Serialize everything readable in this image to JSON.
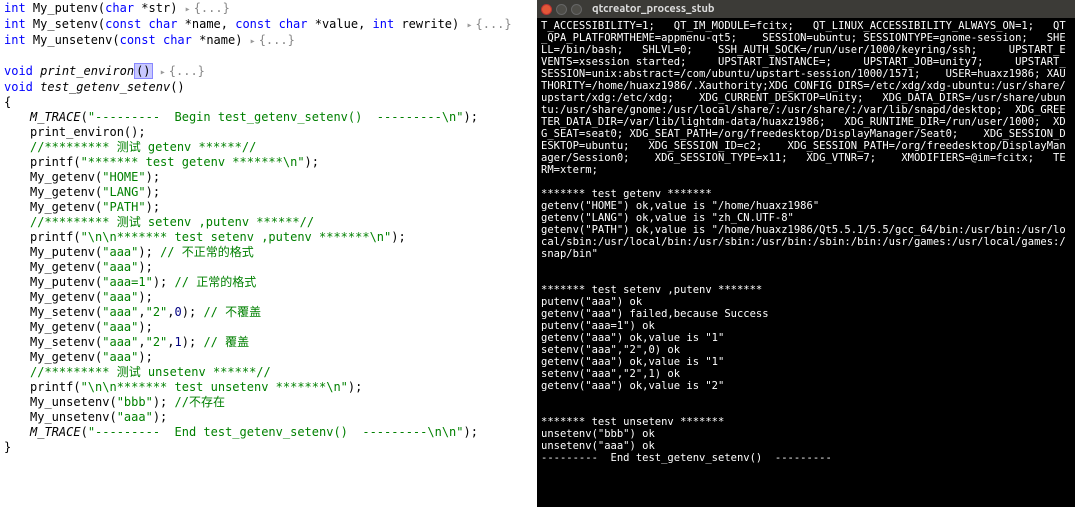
{
  "editor": {
    "lines": [
      {
        "indent": 0,
        "tokens": [
          {
            "t": "kw",
            "v": "int"
          },
          {
            "t": "",
            "v": " My_putenv("
          },
          {
            "t": "kw",
            "v": "char"
          },
          {
            "t": "",
            "v": " *str) "
          },
          {
            "t": "fold",
            "v": "{...}"
          }
        ]
      },
      {
        "indent": 0,
        "tokens": [
          {
            "t": "kw",
            "v": "int"
          },
          {
            "t": "",
            "v": " My_setenv("
          },
          {
            "t": "kw",
            "v": "const"
          },
          {
            "t": "",
            "v": " "
          },
          {
            "t": "kw",
            "v": "char"
          },
          {
            "t": "",
            "v": " *name, "
          },
          {
            "t": "kw",
            "v": "const"
          },
          {
            "t": "",
            "v": " "
          },
          {
            "t": "kw",
            "v": "char"
          },
          {
            "t": "",
            "v": " *value, "
          },
          {
            "t": "kw",
            "v": "int"
          },
          {
            "t": "",
            "v": " rewrite) "
          },
          {
            "t": "fold",
            "v": "{...}"
          }
        ]
      },
      {
        "indent": 0,
        "tokens": [
          {
            "t": "kw",
            "v": "int"
          },
          {
            "t": "",
            "v": " My_unsetenv("
          },
          {
            "t": "kw",
            "v": "const"
          },
          {
            "t": "",
            "v": " "
          },
          {
            "t": "kw",
            "v": "char"
          },
          {
            "t": "",
            "v": " *name) "
          },
          {
            "t": "fold",
            "v": "{...}"
          }
        ]
      },
      {
        "indent": 0,
        "tokens": []
      },
      {
        "indent": 0,
        "tokens": [
          {
            "t": "kw",
            "v": "void"
          },
          {
            "t": "",
            "v": " "
          },
          {
            "t": "fn",
            "v": "print_environ"
          },
          {
            "t": "car",
            "v": "()"
          },
          {
            "t": "",
            "v": " "
          },
          {
            "t": "fold",
            "v": "{...}"
          }
        ]
      },
      {
        "indent": 0,
        "tokens": [
          {
            "t": "kw",
            "v": "void"
          },
          {
            "t": "",
            "v": " "
          },
          {
            "t": "fn",
            "v": "test_getenv_setenv"
          },
          {
            "t": "",
            "v": "()"
          }
        ]
      },
      {
        "indent": 0,
        "tokens": [
          {
            "t": "",
            "v": "{"
          }
        ]
      },
      {
        "indent": 1,
        "tokens": [
          {
            "t": "fn",
            "v": "M_TRACE"
          },
          {
            "t": "",
            "v": "("
          },
          {
            "t": "str",
            "v": "\"---------  Begin test_getenv_setenv()  ---------\\n\""
          },
          {
            "t": "",
            "v": ");"
          }
        ]
      },
      {
        "indent": 1,
        "tokens": [
          {
            "t": "",
            "v": "print_environ();"
          }
        ]
      },
      {
        "indent": 1,
        "tokens": [
          {
            "t": "cmt",
            "v": "//********* 测试 getenv ******//"
          }
        ]
      },
      {
        "indent": 1,
        "tokens": [
          {
            "t": "",
            "v": "printf("
          },
          {
            "t": "str",
            "v": "\"******* test getenv *******\\n\""
          },
          {
            "t": "",
            "v": ");"
          }
        ]
      },
      {
        "indent": 1,
        "tokens": [
          {
            "t": "",
            "v": "My_getenv("
          },
          {
            "t": "str",
            "v": "\"HOME\""
          },
          {
            "t": "",
            "v": ");"
          }
        ]
      },
      {
        "indent": 1,
        "tokens": [
          {
            "t": "",
            "v": "My_getenv("
          },
          {
            "t": "str",
            "v": "\"LANG\""
          },
          {
            "t": "",
            "v": ");"
          }
        ]
      },
      {
        "indent": 1,
        "tokens": [
          {
            "t": "",
            "v": "My_getenv("
          },
          {
            "t": "str",
            "v": "\"PATH\""
          },
          {
            "t": "",
            "v": ");"
          }
        ]
      },
      {
        "indent": 1,
        "tokens": [
          {
            "t": "cmt",
            "v": "//********* 测试 setenv ,putenv ******//"
          }
        ]
      },
      {
        "indent": 1,
        "tokens": [
          {
            "t": "",
            "v": "printf("
          },
          {
            "t": "str",
            "v": "\"\\n\\n******* test setenv ,putenv *******\\n\""
          },
          {
            "t": "",
            "v": ");"
          }
        ]
      },
      {
        "indent": 1,
        "tokens": [
          {
            "t": "",
            "v": "My_putenv("
          },
          {
            "t": "str",
            "v": "\"aaa\""
          },
          {
            "t": "",
            "v": "); "
          },
          {
            "t": "cmt",
            "v": "// 不正常的格式"
          }
        ]
      },
      {
        "indent": 1,
        "tokens": [
          {
            "t": "",
            "v": "My_getenv("
          },
          {
            "t": "str",
            "v": "\"aaa\""
          },
          {
            "t": "",
            "v": ");"
          }
        ]
      },
      {
        "indent": 1,
        "tokens": [
          {
            "t": "",
            "v": "My_putenv("
          },
          {
            "t": "str",
            "v": "\"aaa=1\""
          },
          {
            "t": "",
            "v": "); "
          },
          {
            "t": "cmt",
            "v": "// 正常的格式"
          }
        ]
      },
      {
        "indent": 1,
        "tokens": [
          {
            "t": "",
            "v": "My_getenv("
          },
          {
            "t": "str",
            "v": "\"aaa\""
          },
          {
            "t": "",
            "v": ");"
          }
        ]
      },
      {
        "indent": 1,
        "tokens": [
          {
            "t": "",
            "v": "My_setenv("
          },
          {
            "t": "str",
            "v": "\"aaa\""
          },
          {
            "t": "",
            "v": ","
          },
          {
            "t": "str",
            "v": "\"2\""
          },
          {
            "t": "",
            "v": ","
          },
          {
            "t": "num",
            "v": "0"
          },
          {
            "t": "",
            "v": "); "
          },
          {
            "t": "cmt",
            "v": "// 不覆盖"
          }
        ]
      },
      {
        "indent": 1,
        "tokens": [
          {
            "t": "",
            "v": "My_getenv("
          },
          {
            "t": "str",
            "v": "\"aaa\""
          },
          {
            "t": "",
            "v": ");"
          }
        ]
      },
      {
        "indent": 1,
        "tokens": [
          {
            "t": "",
            "v": "My_setenv("
          },
          {
            "t": "str",
            "v": "\"aaa\""
          },
          {
            "t": "",
            "v": ","
          },
          {
            "t": "str",
            "v": "\"2\""
          },
          {
            "t": "",
            "v": ","
          },
          {
            "t": "num",
            "v": "1"
          },
          {
            "t": "",
            "v": "); "
          },
          {
            "t": "cmt",
            "v": "// 覆盖"
          }
        ]
      },
      {
        "indent": 1,
        "tokens": [
          {
            "t": "",
            "v": "My_getenv("
          },
          {
            "t": "str",
            "v": "\"aaa\""
          },
          {
            "t": "",
            "v": ");"
          }
        ]
      },
      {
        "indent": 1,
        "tokens": [
          {
            "t": "cmt",
            "v": "//********* 测试 unsetenv ******//"
          }
        ]
      },
      {
        "indent": 1,
        "tokens": [
          {
            "t": "",
            "v": "printf("
          },
          {
            "t": "str",
            "v": "\"\\n\\n******* test unsetenv *******\\n\""
          },
          {
            "t": "",
            "v": ");"
          }
        ]
      },
      {
        "indent": 1,
        "tokens": [
          {
            "t": "",
            "v": "My_unsetenv("
          },
          {
            "t": "str",
            "v": "\"bbb\""
          },
          {
            "t": "",
            "v": "); "
          },
          {
            "t": "cmt",
            "v": "//不存在"
          }
        ]
      },
      {
        "indent": 1,
        "tokens": [
          {
            "t": "",
            "v": "My_unsetenv("
          },
          {
            "t": "str",
            "v": "\"aaa\""
          },
          {
            "t": "",
            "v": ");"
          }
        ]
      },
      {
        "indent": 1,
        "tokens": [
          {
            "t": "fn",
            "v": "M_TRACE"
          },
          {
            "t": "",
            "v": "("
          },
          {
            "t": "str",
            "v": "\"---------  End test_getenv_setenv()  ---------\\n\\n\""
          },
          {
            "t": "",
            "v": ");"
          }
        ]
      },
      {
        "indent": 0,
        "tokens": [
          {
            "t": "",
            "v": "}"
          }
        ]
      }
    ]
  },
  "terminal": {
    "title": "qtcreator_process_stub",
    "lines": [
      "T_ACCESSIBILITY=1;   QT_IM_MODULE=fcitx;   QT_LINUX_ACCESSIBILITY_ALWAYS_ON=1;   QT_QPA_PLATFORMTHEME=appmenu-qt5;    SESSION=ubuntu; SESSIONTYPE=gnome-session;   SHELL=/bin/bash;   SHLVL=0;    SSH_AUTH_SOCK=/run/user/1000/keyring/ssh;     UPSTART_EVENTS=xsession started;     UPSTART_INSTANCE=;     UPSTART_JOB=unity7;     UPSTART_SESSION=unix:abstract=/com/ubuntu/upstart-session/1000/1571;    USER=huaxz1986; XAUTHORITY=/home/huaxz1986/.Xauthority;XDG_CONFIG_DIRS=/etc/xdg/xdg-ubuntu:/usr/share/upstart/xdg:/etc/xdg;    XDG_CURRENT_DESKTOP=Unity;   XDG_DATA_DIRS=/usr/share/ubuntu:/usr/share/gnome:/usr/local/share/:/usr/share/:/var/lib/snapd/desktop;  XDG_GREETER_DATA_DIR=/var/lib/lightdm-data/huaxz1986;   XDG_RUNTIME_DIR=/run/user/1000;  XDG_SEAT=seat0; XDG_SEAT_PATH=/org/freedesktop/DisplayManager/Seat0;    XDG_SESSION_DESKTOP=ubuntu;   XDG_SESSION_ID=c2;    XDG_SESSION_PATH=/org/freedesktop/DisplayManager/Session0;    XDG_SESSION_TYPE=x11;   XDG_VTNR=7;    XMODIFIERS=@im=fcitx;   TERM=xterm;",
      "",
      "******* test getenv *******",
      "getenv(\"HOME\") ok,value is \"/home/huaxz1986\"",
      "getenv(\"LANG\") ok,value is \"zh_CN.UTF-8\"",
      "getenv(\"PATH\") ok,value is \"/home/huaxz1986/Qt5.5.1/5.5/gcc_64/bin:/usr/bin:/usr/local/sbin:/usr/local/bin:/usr/sbin:/usr/bin:/sbin:/bin:/usr/games:/usr/local/games:/snap/bin\"",
      "",
      "",
      "******* test setenv ,putenv *******",
      "putenv(\"aaa\") ok",
      "getenv(\"aaa\") failed,because Success",
      "putenv(\"aaa=1\") ok",
      "getenv(\"aaa\") ok,value is \"1\"",
      "setenv(\"aaa\",\"2\",0) ok",
      "getenv(\"aaa\") ok,value is \"1\"",
      "setenv(\"aaa\",\"2\",1) ok",
      "getenv(\"aaa\") ok,value is \"2\"",
      "",
      "",
      "******* test unsetenv *******",
      "unsetenv(\"bbb\") ok",
      "unsetenv(\"aaa\") ok",
      "---------  End test_getenv_setenv()  ---------"
    ]
  }
}
